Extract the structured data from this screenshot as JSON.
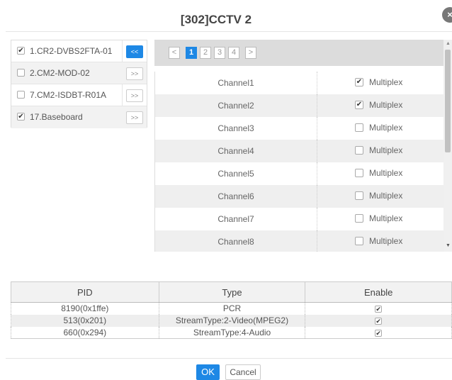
{
  "dialog": {
    "title": "[302]CCTV 2",
    "close_glyph": "×"
  },
  "devices": [
    {
      "label": "1.CR2-DVBS2FTA-01",
      "checked": true,
      "button": "<<",
      "active": true
    },
    {
      "label": "2.CM2-MOD-02",
      "checked": false,
      "button": ">>",
      "active": false
    },
    {
      "label": "7.CM2-ISDBT-R01A",
      "checked": false,
      "button": ">>",
      "active": false
    },
    {
      "label": "17.Baseboard",
      "checked": true,
      "button": ">>",
      "active": false
    }
  ],
  "pager": {
    "prev": "<",
    "next": ">",
    "pages": [
      "1",
      "2",
      "3",
      "4"
    ],
    "current": "1"
  },
  "channels": [
    {
      "name": "Channel1",
      "mux_label": "Multiplex",
      "checked": true
    },
    {
      "name": "Channel2",
      "mux_label": "Multiplex",
      "checked": true
    },
    {
      "name": "Channel3",
      "mux_label": "Multiplex",
      "checked": false
    },
    {
      "name": "Channel4",
      "mux_label": "Multiplex",
      "checked": false
    },
    {
      "name": "Channel5",
      "mux_label": "Multiplex",
      "checked": false
    },
    {
      "name": "Channel6",
      "mux_label": "Multiplex",
      "checked": false
    },
    {
      "name": "Channel7",
      "mux_label": "Multiplex",
      "checked": false
    },
    {
      "name": "Channel8",
      "mux_label": "Multiplex",
      "checked": false
    }
  ],
  "pid_table": {
    "headers": {
      "pid": "PID",
      "type": "Type",
      "enable": "Enable"
    },
    "rows": [
      {
        "pid": "8190(0x1ffe)",
        "type": "PCR",
        "enabled": true
      },
      {
        "pid": "513(0x201)",
        "type": "StreamType:2-Video(MPEG2)",
        "enabled": true
      },
      {
        "pid": "660(0x294)",
        "type": "StreamType:4-Audio",
        "enabled": true
      }
    ]
  },
  "footer": {
    "ok_label": "OK",
    "cancel_label": "Cancel"
  },
  "colors": {
    "accent": "#1e88e5"
  }
}
